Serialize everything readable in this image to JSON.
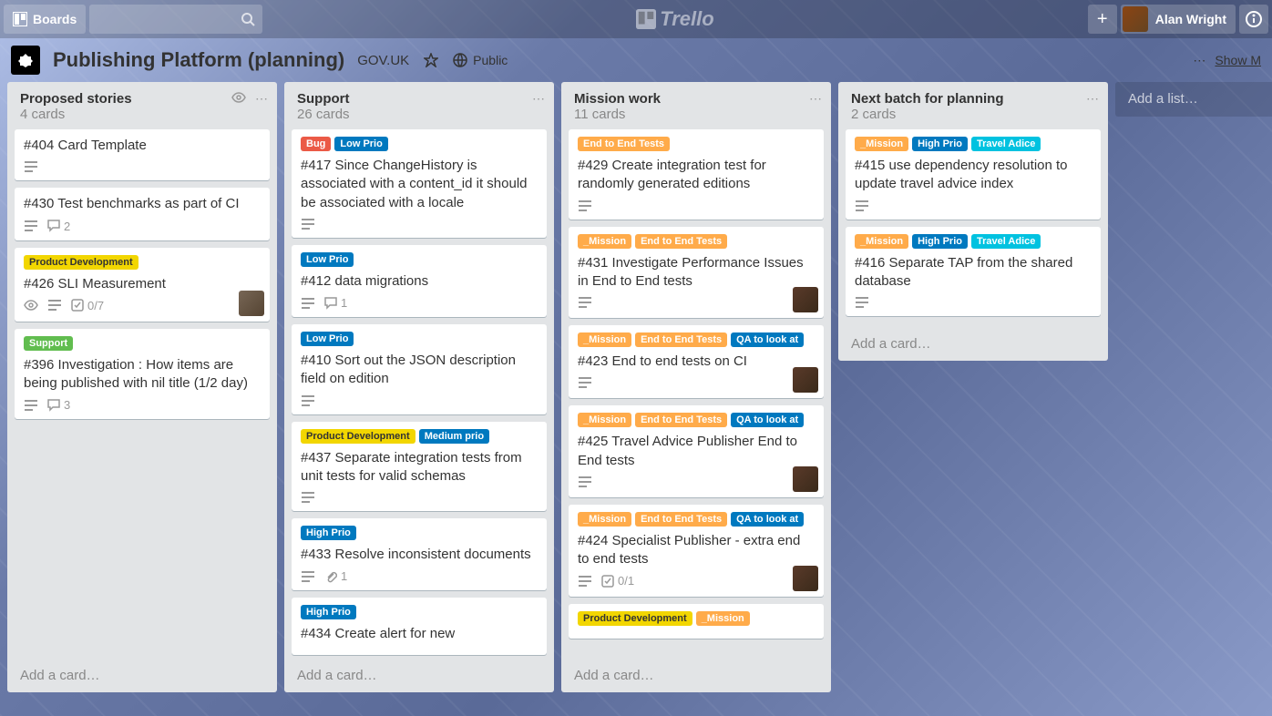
{
  "header": {
    "boards_label": "Boards",
    "logo_text": "Trello",
    "user_name": "Alan Wright"
  },
  "board": {
    "title": "Publishing Platform (planning)",
    "org": "GOV.UK",
    "visibility": "Public",
    "show_menu": "Show M",
    "add_list": "Add a list…"
  },
  "label_colors": {
    "Bug": "#eb5a46",
    "Low Prio": "#0079bf",
    "Product Development": "#f2d600",
    "Support": "#61bd4f",
    "Medium prio": "#0079bf",
    "High Prio": "#0079bf",
    "_Mission": "#ffab4a",
    "End to End Tests": "#ffab4a",
    "QA to look at": "#0079bf",
    "Travel Adice": "#00c2e0"
  },
  "lists": [
    {
      "title": "Proposed stories",
      "count": "4 cards",
      "has_watch": true,
      "cards": [
        {
          "title": "#404 Card Template",
          "labels": [],
          "badges": {
            "desc": true
          }
        },
        {
          "title": "#430 Test benchmarks as part of CI",
          "labels": [],
          "badges": {
            "desc": true,
            "comments": "2"
          }
        },
        {
          "title": "#426 SLI Measurement",
          "labels": [
            "Product Development"
          ],
          "badges": {
            "watch": true,
            "desc": true,
            "checklist": "0/7"
          },
          "avatar": "l"
        },
        {
          "title": "#396 Investigation : How items are being published with nil title (1/2 day)",
          "labels": [
            "Support"
          ],
          "badges": {
            "desc": true,
            "comments": "3"
          }
        }
      ],
      "add_card": "Add a card…"
    },
    {
      "title": "Support",
      "count": "26 cards",
      "cards": [
        {
          "title": "#417 Since ChangeHistory is associated with a content_id it should be associated with a locale",
          "labels": [
            "Bug",
            "Low Prio"
          ],
          "badges": {
            "desc": true
          }
        },
        {
          "title": "#412 data migrations",
          "labels": [
            "Low Prio"
          ],
          "badges": {
            "desc": true,
            "comments": "1"
          }
        },
        {
          "title": "#410 Sort out the JSON description field on edition",
          "labels": [
            "Low Prio"
          ],
          "badges": {
            "desc": true
          }
        },
        {
          "title": "#437 Separate integration tests from unit tests for valid schemas",
          "labels": [
            "Product Development",
            "Medium prio"
          ],
          "badges": {
            "desc": true
          }
        },
        {
          "title": "#433 Resolve inconsistent documents",
          "labels": [
            "High Prio"
          ],
          "badges": {
            "desc": true,
            "attachments": "1"
          }
        },
        {
          "title": "#434 Create alert for new",
          "labels": [
            "High Prio"
          ],
          "badges": {}
        }
      ],
      "add_card": "Add a card…"
    },
    {
      "title": "Mission work",
      "count": "11 cards",
      "cards": [
        {
          "title": "#429 Create integration test for randomly generated editions",
          "labels": [
            "End to End Tests"
          ],
          "badges": {
            "desc": true
          }
        },
        {
          "title": "#431 Investigate Performance Issues in End to End tests",
          "labels": [
            "_Mission",
            "End to End Tests"
          ],
          "badges": {
            "desc": true
          },
          "avatar": "d"
        },
        {
          "title": "#423 End to end tests on CI",
          "labels": [
            "_Mission",
            "End to End Tests",
            "QA to look at"
          ],
          "badges": {
            "desc": true
          },
          "avatar": "d"
        },
        {
          "title": "#425 Travel Advice Publisher End to End tests",
          "labels": [
            "_Mission",
            "End to End Tests",
            "QA to look at"
          ],
          "badges": {
            "desc": true
          },
          "avatar": "d"
        },
        {
          "title": "#424 Specialist Publisher - extra end to end tests",
          "labels": [
            "_Mission",
            "End to End Tests",
            "QA to look at"
          ],
          "badges": {
            "desc": true,
            "checklist": "0/1"
          },
          "avatar": "d"
        },
        {
          "title": "",
          "labels": [
            "Product Development",
            "_Mission"
          ],
          "badges": {}
        }
      ],
      "add_card": "Add a card…"
    },
    {
      "title": "Next batch for planning",
      "count": "2 cards",
      "cards": [
        {
          "title": "#415 use dependency resolution to update travel advice index",
          "labels": [
            "_Mission",
            "High Prio",
            "Travel Adice"
          ],
          "badges": {
            "desc": true
          }
        },
        {
          "title": "#416 Separate TAP from the shared database",
          "labels": [
            "_Mission",
            "High Prio",
            "Travel Adice"
          ],
          "badges": {
            "desc": true
          }
        }
      ],
      "add_card": "Add a card…"
    }
  ]
}
